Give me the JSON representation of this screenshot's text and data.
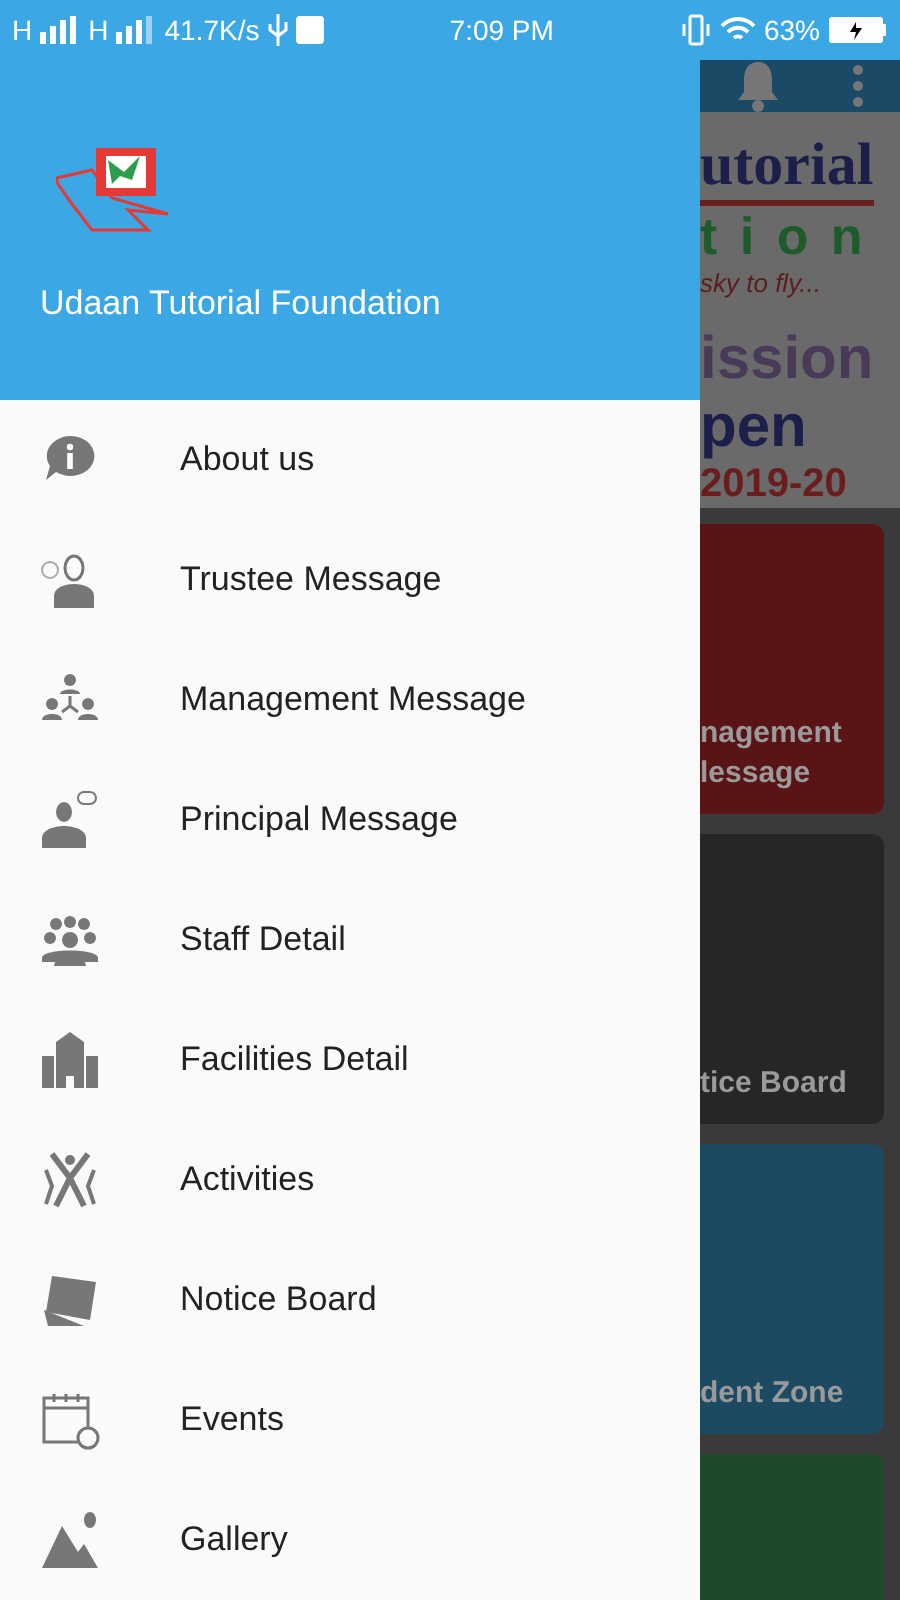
{
  "status_bar": {
    "network_1": "H",
    "network_2": "H",
    "speed": "41.7K/s",
    "time": "7:09 PM",
    "battery": "63%"
  },
  "drawer": {
    "title": "Udaan Tutorial Foundation",
    "items": [
      {
        "label": "About us"
      },
      {
        "label": "Trustee Message"
      },
      {
        "label": "Management Message"
      },
      {
        "label": "Principal Message"
      },
      {
        "label": "Staff Detail"
      },
      {
        "label": "Facilities Detail"
      },
      {
        "label": "Activities"
      },
      {
        "label": "Notice Board"
      },
      {
        "label": "Events"
      },
      {
        "label": "Gallery"
      }
    ]
  },
  "background": {
    "banner": {
      "title": "utorial",
      "subtitle": "t i o n",
      "tagline": "sky  to  fly...",
      "line_1": "ission",
      "line_2": "pen",
      "year": "2019-20"
    },
    "cards": [
      {
        "lines": [
          "nagement",
          "lessage"
        ],
        "color": "#5a1416"
      },
      {
        "lines": [
          "tice Board"
        ],
        "color": "#262626"
      },
      {
        "lines": [
          "dent Zone"
        ],
        "color": "#1c4a63"
      },
      {
        "color": "#1d4a2a"
      }
    ]
  }
}
